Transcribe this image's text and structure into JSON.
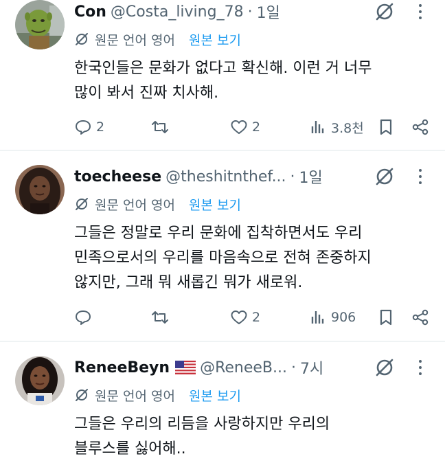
{
  "translate_bar": {
    "label": "원문 언어 영어",
    "link": "원본 보기"
  },
  "tweets": [
    {
      "name": "Con",
      "handle": "@Costa_living_78",
      "dot": "·",
      "time": "1일",
      "text_lines": [
        "한국인들은 문화가 없다고 확신해. 이런 거 너무",
        "많이 봐서 진짜 치사해."
      ],
      "replies": "2",
      "retweets": "",
      "likes": "2",
      "views": "3.8천"
    },
    {
      "name": "toecheese",
      "handle": "@theshitnthef...",
      "dot": "·",
      "time": "1일",
      "text_lines": [
        "그들은 정말로 우리 문화에 집착하면서도 우리",
        "민족으로서의 우리를 마음속으로 전혀 존중하지",
        "않지만, 그래 뭐 새롭긴 뭐가 새로워."
      ],
      "replies": "",
      "retweets": "",
      "likes": "2",
      "views": "906"
    },
    {
      "name": "ReneeBeyn",
      "handle": "@ReneeB...",
      "dot": "·",
      "time": "7시",
      "text_lines": [
        "그들은 우리의 리듬을 사랑하지만 우리의",
        "블루스를 싫어해.."
      ]
    }
  ],
  "colors": {
    "text": "#0f1419",
    "secondary": "#536471",
    "link": "#1d9bf0",
    "divider": "#eff3f4"
  }
}
